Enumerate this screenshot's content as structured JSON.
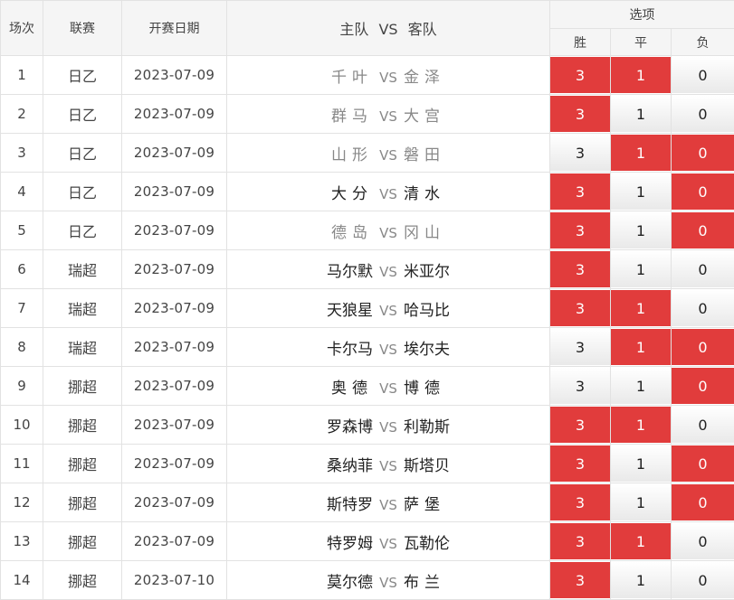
{
  "headers": {
    "no": "场次",
    "league": "联赛",
    "date": "开赛日期",
    "match_home": "主队",
    "match_vs": "VS",
    "match_away": "客队",
    "options": "选项",
    "win": "胜",
    "draw": "平",
    "lose": "负"
  },
  "colors": {
    "selected": "#e13c3c",
    "unselected": "#f0f0f0",
    "border": "#e2e2e2",
    "header_bg": "#f5f5f5"
  },
  "rows": [
    {
      "no": "1",
      "league": "日乙",
      "date": "2023-07-09",
      "home": "千叶",
      "vs": "VS",
      "away": "金泽",
      "win": "3",
      "draw": "1",
      "lose": "0",
      "sel": [
        true,
        true,
        false
      ],
      "team_style": "gray"
    },
    {
      "no": "2",
      "league": "日乙",
      "date": "2023-07-09",
      "home": "群马",
      "vs": "VS",
      "away": "大宫",
      "win": "3",
      "draw": "1",
      "lose": "0",
      "sel": [
        true,
        false,
        false
      ],
      "team_style": "gray"
    },
    {
      "no": "3",
      "league": "日乙",
      "date": "2023-07-09",
      "home": "山形",
      "vs": "VS",
      "away": "磐田",
      "win": "3",
      "draw": "1",
      "lose": "0",
      "sel": [
        false,
        true,
        true
      ],
      "team_style": "gray"
    },
    {
      "no": "4",
      "league": "日乙",
      "date": "2023-07-09",
      "home": "大分",
      "vs": "VS",
      "away": "清水",
      "win": "3",
      "draw": "1",
      "lose": "0",
      "sel": [
        true,
        false,
        true
      ],
      "team_style": "dark"
    },
    {
      "no": "5",
      "league": "日乙",
      "date": "2023-07-09",
      "home": "德岛",
      "vs": "VS",
      "away": "冈山",
      "win": "3",
      "draw": "1",
      "lose": "0",
      "sel": [
        true,
        false,
        true
      ],
      "team_style": "gray"
    },
    {
      "no": "6",
      "league": "瑞超",
      "date": "2023-07-09",
      "home": "马尔默",
      "vs": "VS",
      "away": "米亚尔",
      "win": "3",
      "draw": "1",
      "lose": "0",
      "sel": [
        true,
        false,
        false
      ],
      "team_style": "dark"
    },
    {
      "no": "7",
      "league": "瑞超",
      "date": "2023-07-09",
      "home": "天狼星",
      "vs": "VS",
      "away": "哈马比",
      "win": "3",
      "draw": "1",
      "lose": "0",
      "sel": [
        true,
        true,
        false
      ],
      "team_style": "dark"
    },
    {
      "no": "8",
      "league": "瑞超",
      "date": "2023-07-09",
      "home": "卡尔马",
      "vs": "VS",
      "away": "埃尔夫",
      "win": "3",
      "draw": "1",
      "lose": "0",
      "sel": [
        false,
        true,
        true
      ],
      "team_style": "dark"
    },
    {
      "no": "9",
      "league": "挪超",
      "date": "2023-07-09",
      "home": "奥德",
      "vs": "VS",
      "away": "博德",
      "win": "3",
      "draw": "1",
      "lose": "0",
      "sel": [
        false,
        false,
        true
      ],
      "team_style": "dark"
    },
    {
      "no": "10",
      "league": "挪超",
      "date": "2023-07-09",
      "home": "罗森博",
      "vs": "VS",
      "away": "利勒斯",
      "win": "3",
      "draw": "1",
      "lose": "0",
      "sel": [
        true,
        true,
        false
      ],
      "team_style": "dark"
    },
    {
      "no": "11",
      "league": "挪超",
      "date": "2023-07-09",
      "home": "桑纳菲",
      "vs": "VS",
      "away": "斯塔贝",
      "win": "3",
      "draw": "1",
      "lose": "0",
      "sel": [
        true,
        false,
        true
      ],
      "team_style": "dark"
    },
    {
      "no": "12",
      "league": "挪超",
      "date": "2023-07-09",
      "home": "斯特罗",
      "vs": "VS",
      "away": "萨堡",
      "win": "3",
      "draw": "1",
      "lose": "0",
      "sel": [
        true,
        false,
        true
      ],
      "team_style": "dark"
    },
    {
      "no": "13",
      "league": "挪超",
      "date": "2023-07-09",
      "home": "特罗姆",
      "vs": "VS",
      "away": "瓦勒伦",
      "win": "3",
      "draw": "1",
      "lose": "0",
      "sel": [
        true,
        true,
        false
      ],
      "team_style": "dark"
    },
    {
      "no": "14",
      "league": "挪超",
      "date": "2023-07-10",
      "home": "莫尔德",
      "vs": "VS",
      "away": "布兰",
      "win": "3",
      "draw": "1",
      "lose": "0",
      "sel": [
        true,
        false,
        false
      ],
      "team_style": "dark"
    }
  ]
}
